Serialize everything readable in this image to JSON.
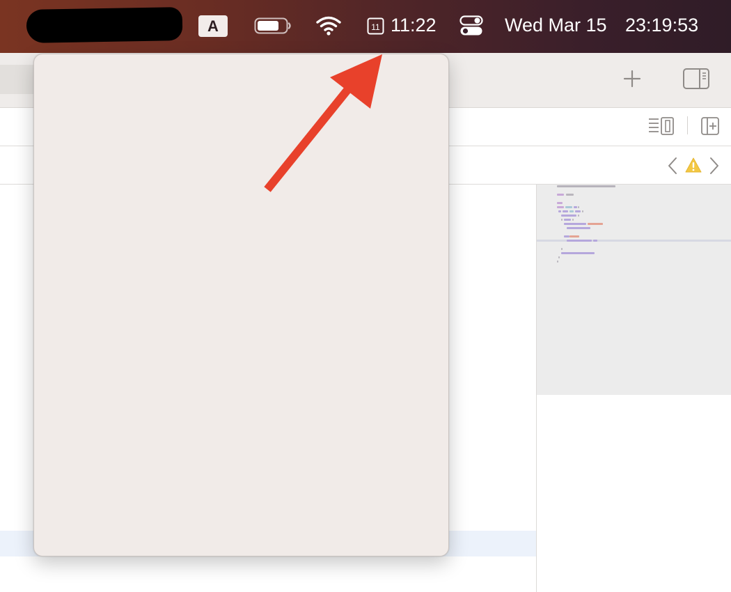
{
  "menubar": {
    "input_source_label": "A",
    "calendar_day": "11",
    "clock_small": "11:22",
    "date": "Wed Mar 15",
    "time": "23:19:53",
    "icons": {
      "battery": "battery-icon",
      "wifi": "wifi-icon",
      "calendar": "calendar-icon",
      "control_center": "control-center-icon"
    }
  },
  "toolbar": {
    "icons": {
      "add": "plus-icon",
      "inspector": "sidebar-right-icon",
      "editor_options": "editor-options-icon",
      "add_editor": "add-editor-icon",
      "nav_back": "chevron-left-icon",
      "warning": "warning-icon",
      "nav_forward": "chevron-right-icon"
    }
  },
  "colors": {
    "menubar_start": "#7a3422",
    "menubar_end": "#2f1c27",
    "popover_bg": "#f1ebe8",
    "annotation_arrow": "#e8412b",
    "warning": "#f3c843"
  }
}
